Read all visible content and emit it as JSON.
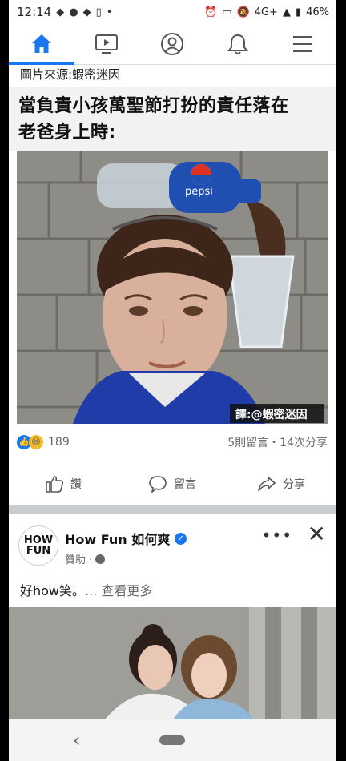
{
  "status_bar": {
    "time": "12:14",
    "network": "4G+",
    "battery": "46%"
  },
  "nav": {
    "tabs": [
      "home",
      "watch",
      "profile",
      "notifications",
      "menu"
    ],
    "active": "home",
    "accent": "#1877f2"
  },
  "post1": {
    "source": "圖片來源:蝦密迷因",
    "headline_line1": "當負責小孩萬聖節打扮的責任落在",
    "headline_line2": "老爸身上時:",
    "photo_bottle_text": "pepsi",
    "photo_watermark": "譯:@蝦密迷因",
    "reaction_count": "189",
    "comments_shares": "5則留言・14次分享",
    "actions": {
      "like": "讚",
      "comment": "留言",
      "share": "分享"
    }
  },
  "post2": {
    "logo_line1": "HOW",
    "logo_line2": "FUN",
    "page_name": "How Fun 如何爽",
    "sponsored": "贊助 · ",
    "more": "•••",
    "close": "✕",
    "text": "好how笑。",
    "see_more": "... 查看更多"
  }
}
